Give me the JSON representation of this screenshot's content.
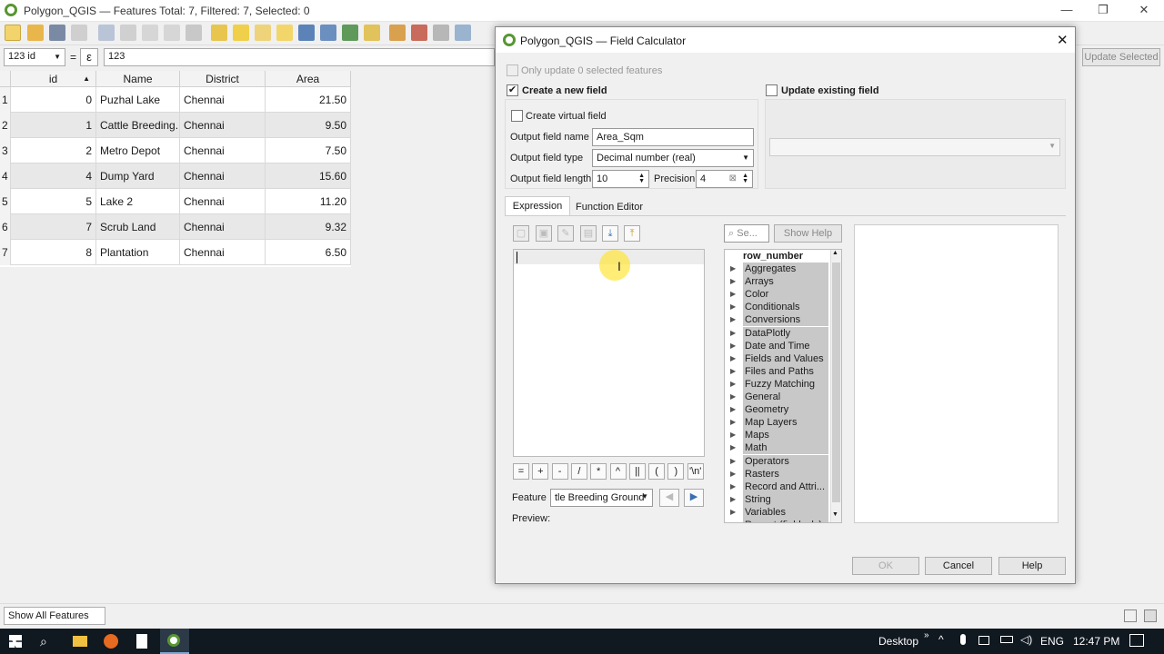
{
  "window": {
    "title": "Polygon_QGIS — Features Total: 7, Filtered: 7, Selected: 0"
  },
  "exprbar": {
    "field": "id",
    "field_prefix": "123",
    "equals": "=",
    "epsilon": "ε",
    "value": "123",
    "update_selected": "Update Selected"
  },
  "table": {
    "columns": [
      "id",
      "Name",
      "District",
      "Area"
    ],
    "rows": [
      {
        "n": "1",
        "id": "0",
        "name": "Puzhal Lake",
        "district": "Chennai",
        "area": "21.50"
      },
      {
        "n": "2",
        "id": "1",
        "name": "Cattle Breeding...",
        "district": "Chennai",
        "area": "9.50"
      },
      {
        "n": "3",
        "id": "2",
        "name": "Metro Depot",
        "district": "Chennai",
        "area": "7.50"
      },
      {
        "n": "4",
        "id": "4",
        "name": "Dump Yard",
        "district": "Chennai",
        "area": "15.60"
      },
      {
        "n": "5",
        "id": "5",
        "name": "Lake 2",
        "district": "Chennai",
        "area": "11.20"
      },
      {
        "n": "6",
        "id": "7",
        "name": "Scrub Land",
        "district": "Chennai",
        "area": "9.32"
      },
      {
        "n": "7",
        "id": "8",
        "name": "Plantation",
        "district": "Chennai",
        "area": "6.50"
      }
    ]
  },
  "status": {
    "show_all": "Show All Features"
  },
  "dialog": {
    "title": "Polygon_QGIS — Field Calculator",
    "only_update": "Only update 0 selected features",
    "create_new": "Create a new field",
    "update_existing": "Update existing field",
    "create_virtual": "Create virtual field",
    "output_name_label": "Output field name",
    "output_name_value": "Area_Sqm",
    "output_type_label": "Output field type",
    "output_type_value": "Decimal number (real)",
    "output_length_label": "Output field length",
    "output_length_value": "10",
    "precision_label": "Precision",
    "precision_value": "4",
    "tabs": [
      "Expression",
      "Function Editor"
    ],
    "search_placeholder": "Se...",
    "show_help": "Show Help",
    "operators": [
      "=",
      "+",
      "-",
      "/",
      "*",
      "^",
      "||",
      "(",
      ")",
      "'\\n'"
    ],
    "feature_label": "Feature",
    "feature_value": "tle Breeding Ground",
    "preview_label": "Preview:",
    "tree_header": "row_number",
    "tree": [
      "Aggregates",
      "Arrays",
      "Color",
      "Conditionals",
      "Conversions",
      "DataPlotly",
      "Date and Time",
      "Fields and Values",
      "Files and Paths",
      "Fuzzy Matching",
      "General",
      "Geometry",
      "Map Layers",
      "Maps",
      "Math",
      "Operators",
      "Rasters",
      "Record and Attri...",
      "String",
      "Variables",
      "Recent (fieldcalc)"
    ],
    "ok": "OK",
    "cancel": "Cancel",
    "help": "Help"
  },
  "taskbar": {
    "desktop": "Desktop",
    "lang": "ENG",
    "time": "12:47 PM"
  }
}
